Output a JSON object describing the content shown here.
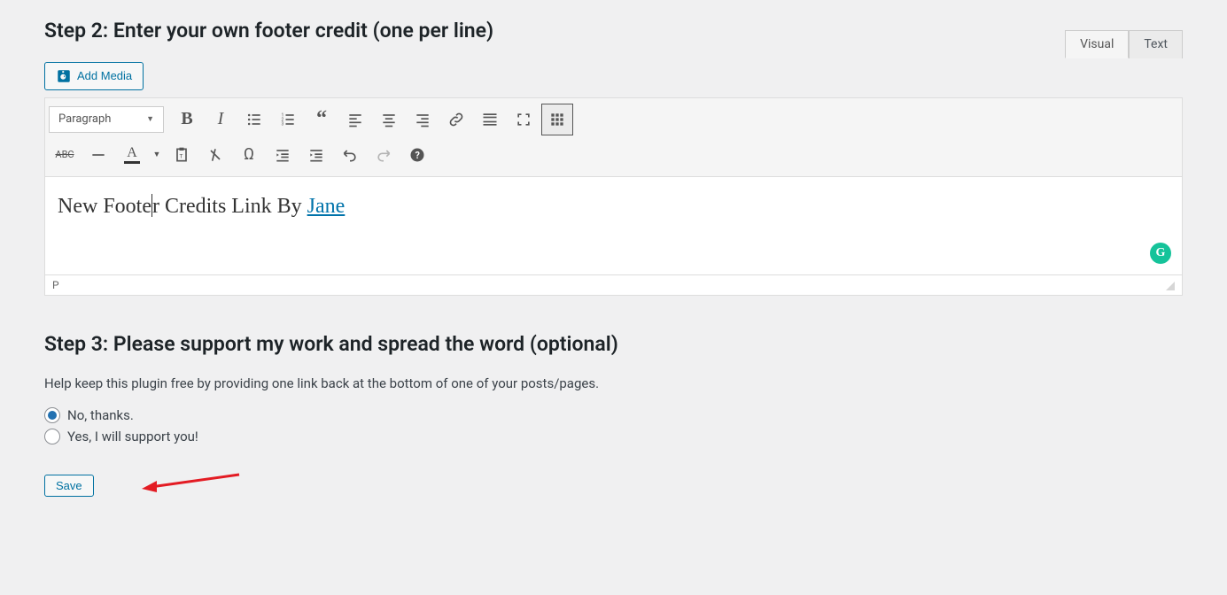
{
  "step2": {
    "title": "Step 2: Enter your own footer credit (one per line)"
  },
  "addMedia": {
    "label": "Add Media"
  },
  "tabs": {
    "visual": "Visual",
    "text": "Text"
  },
  "formatSelect": {
    "value": "Paragraph"
  },
  "editorContent": {
    "prefix1": "New Foote",
    "prefix2": "r Credits Link By ",
    "linkText": "Jane"
  },
  "statusBar": {
    "path": "P"
  },
  "grammarly": {
    "letter": "G"
  },
  "step3": {
    "title": "Step 3: Please support my work and spread the word (optional)"
  },
  "helpText": "Help keep this plugin free by providing one link back at the bottom of one of your posts/pages.",
  "radios": {
    "no": "No, thanks.",
    "yes": "Yes, I will support you!"
  },
  "save": {
    "label": "Save"
  },
  "textColorLetter": "A",
  "abc": "ABC"
}
